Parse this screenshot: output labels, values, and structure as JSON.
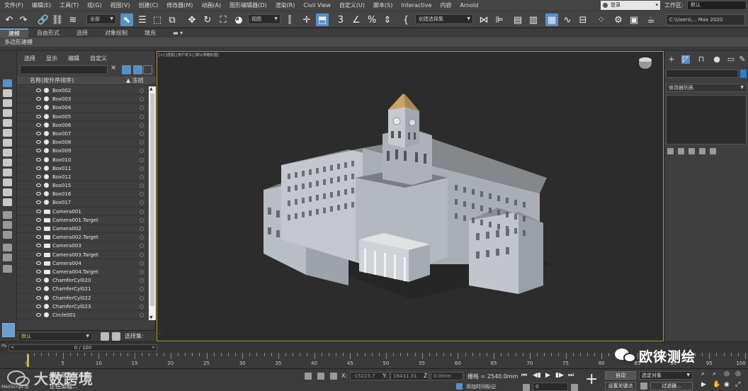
{
  "menubar": {
    "items": [
      "文件(F)",
      "编辑(E)",
      "工具(T)",
      "组(G)",
      "视图(V)",
      "创建(C)",
      "修改器(M)",
      "动画(A)",
      "图形编辑器(D)",
      "渲染(R)",
      "Civil View",
      "自定义(U)",
      "脚本(S)",
      "Interactive",
      "内容",
      "Arnold"
    ],
    "login": "登录",
    "workspace_label": "工作区:",
    "workspace_value": "默认"
  },
  "toolbar": {
    "selection_filter": "全部",
    "ref_coord": "视图",
    "named_selection": "创建选择集",
    "path": "C:\\Users\\… Max 2020"
  },
  "ribbon": {
    "tabs": [
      "建模",
      "自由形式",
      "选择",
      "对象绘制",
      "填充"
    ],
    "active_tab": "建模",
    "sub_label": "多边形建模"
  },
  "explorer": {
    "menu": [
      "选择",
      "显示",
      "编辑",
      "自定义"
    ],
    "col_name": "名称(按升序排序)",
    "col_frozen": "▲ 冻结",
    "items": [
      {
        "name": "Box002",
        "type": "geo"
      },
      {
        "name": "Box003",
        "type": "geo"
      },
      {
        "name": "Box004",
        "type": "geo"
      },
      {
        "name": "Box005",
        "type": "geo"
      },
      {
        "name": "Box006",
        "type": "geo"
      },
      {
        "name": "Box007",
        "type": "geo"
      },
      {
        "name": "Box008",
        "type": "geo"
      },
      {
        "name": "Box009",
        "type": "geo"
      },
      {
        "name": "Box010",
        "type": "geo"
      },
      {
        "name": "Box011",
        "type": "geo"
      },
      {
        "name": "Box012",
        "type": "geo"
      },
      {
        "name": "Box015",
        "type": "geo"
      },
      {
        "name": "Box016",
        "type": "geo"
      },
      {
        "name": "Box017",
        "type": "geo"
      },
      {
        "name": "Camera001",
        "type": "cam"
      },
      {
        "name": "Camera001.Target",
        "type": "cam"
      },
      {
        "name": "Camera002",
        "type": "cam"
      },
      {
        "name": "Camera002.Target",
        "type": "cam"
      },
      {
        "name": "Camera003",
        "type": "cam"
      },
      {
        "name": "Camera003.Target",
        "type": "cam"
      },
      {
        "name": "Camera004",
        "type": "cam"
      },
      {
        "name": "Camera004.Target",
        "type": "cam"
      },
      {
        "name": "ChamferCyl020",
        "type": "geo"
      },
      {
        "name": "ChamferCyl021",
        "type": "geo"
      },
      {
        "name": "ChamferCyl022",
        "type": "geo"
      },
      {
        "name": "ChamferCyl023",
        "type": "geo"
      },
      {
        "name": "Circle001",
        "type": "shape"
      }
    ],
    "layer": "默认",
    "selection_set_label": "选择集:"
  },
  "viewport": {
    "label": "[+] [透视] [用户定义] [默认明暗处理]"
  },
  "command_panel": {
    "modifier_list": "修改器列表"
  },
  "timeline": {
    "frame_display": "0 / 100",
    "ticks": [
      0,
      5,
      10,
      15,
      20,
      25,
      30,
      35,
      40,
      45,
      50,
      55,
      60,
      65,
      70,
      75,
      80,
      85,
      90,
      95,
      100
    ]
  },
  "statusbar": {
    "maxscript": "MAXScript 迷",
    "selected": "未选定任何对象",
    "loading": "正在加载...",
    "x_label": "X:",
    "x_value": "-15223.7",
    "y_label": "Y:",
    "y_value": "16431.31",
    "z_label": "Z:",
    "z_value": "0.0mm",
    "grid": "栅格 = 2540.0mm",
    "add_time_tag": "添加时间标记",
    "frame": "0",
    "auto_key": "自动",
    "set_key": "设置关键点",
    "selected_objects": "选定对象",
    "filters": "过滤器..."
  },
  "watermarks": {
    "right": "欧徕测绘",
    "left": "大数跨境"
  }
}
